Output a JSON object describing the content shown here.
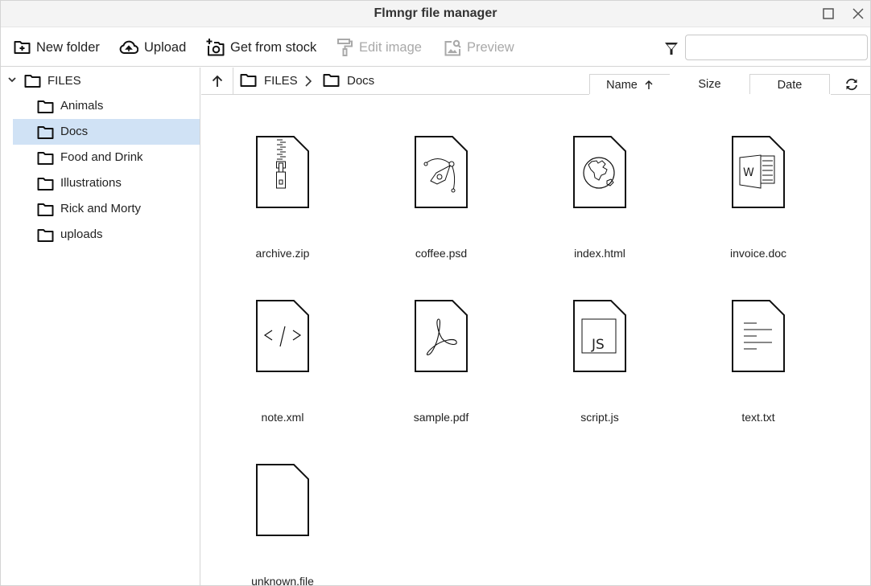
{
  "window": {
    "title": "Flmngr file manager",
    "maximize_icon": "maximize-icon",
    "close_icon": "close-icon"
  },
  "toolbar": {
    "new_folder": {
      "label": "New folder",
      "icon": "folder-plus-icon",
      "enabled": true
    },
    "upload": {
      "label": "Upload",
      "icon": "cloud-upload-icon",
      "enabled": true
    },
    "get_from_stock": {
      "label": "Get from stock",
      "icon": "camera-plus-icon",
      "enabled": true
    },
    "edit_image": {
      "label": "Edit image",
      "icon": "paint-roller-icon",
      "enabled": false
    },
    "preview": {
      "label": "Preview",
      "icon": "image-search-icon",
      "enabled": false
    },
    "filter_icon": "filter-icon",
    "search": {
      "value": "",
      "placeholder": ""
    }
  },
  "sidebar": {
    "root": {
      "label": "FILES",
      "expanded": true
    },
    "items": [
      {
        "label": "Animals",
        "selected": false
      },
      {
        "label": "Docs",
        "selected": true
      },
      {
        "label": "Food and Drink",
        "selected": false
      },
      {
        "label": "Illustrations",
        "selected": false
      },
      {
        "label": "Rick and Morty",
        "selected": false
      },
      {
        "label": "uploads",
        "selected": false
      }
    ]
  },
  "breadcrumb": {
    "items": [
      "FILES",
      "Docs"
    ]
  },
  "sort": {
    "columns": [
      "Name",
      "Size",
      "Date"
    ],
    "active": "Name",
    "direction": "ascending"
  },
  "files": [
    {
      "name": "archive.zip",
      "icon": "zip-file-icon"
    },
    {
      "name": "coffee.psd",
      "icon": "psd-file-icon"
    },
    {
      "name": "index.html",
      "icon": "html-file-icon"
    },
    {
      "name": "invoice.doc",
      "icon": "word-file-icon"
    },
    {
      "name": "note.xml",
      "icon": "xml-file-icon"
    },
    {
      "name": "sample.pdf",
      "icon": "pdf-file-icon"
    },
    {
      "name": "script.js",
      "icon": "js-file-icon"
    },
    {
      "name": "text.txt",
      "icon": "text-file-icon"
    },
    {
      "name": "unknown.file",
      "icon": "unknown-file-icon"
    }
  ],
  "colors": {
    "selected_bg": "#d0e2f5",
    "titlebar_bg": "#f4f4f4",
    "border": "#d4d4d4",
    "disabled_text": "#a9a9a9"
  }
}
